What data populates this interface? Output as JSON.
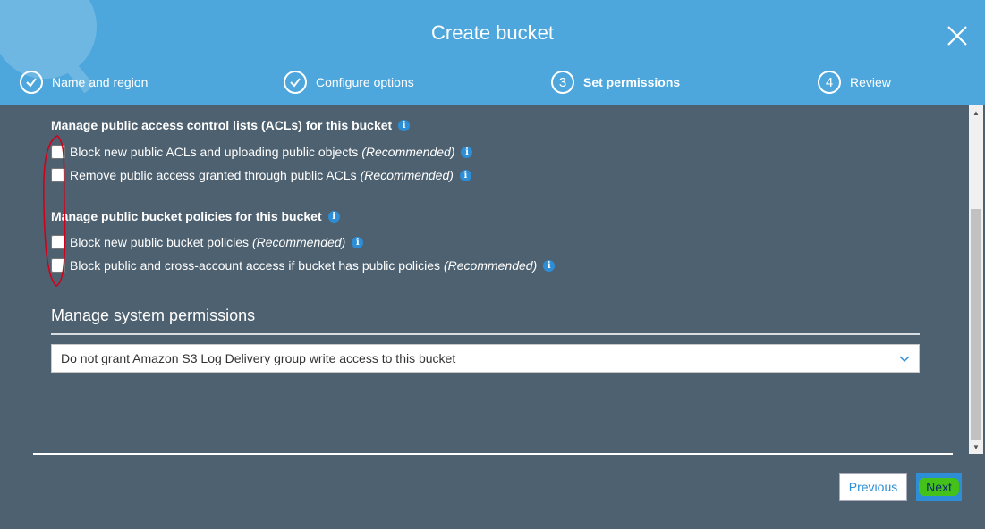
{
  "header": {
    "title": "Create bucket",
    "bg_color": "#4ea7dc",
    "close_icon": "close-x-icon"
  },
  "steps": [
    {
      "marker": "check",
      "label": "Name and region",
      "state": "complete"
    },
    {
      "marker": "check",
      "label": "Configure options",
      "state": "complete"
    },
    {
      "marker": "3",
      "label": "Set permissions",
      "state": "active"
    },
    {
      "marker": "4",
      "label": "Review",
      "state": "pending"
    }
  ],
  "acl_section": {
    "heading": "Manage public access control lists (ACLs) for this bucket",
    "options": [
      {
        "label": "Block new public ACLs and uploading public objects",
        "tag": "(Recommended)",
        "checked": false
      },
      {
        "label": "Remove public access granted through public ACLs",
        "tag": "(Recommended)",
        "checked": false
      }
    ]
  },
  "policy_section": {
    "heading": "Manage public bucket policies for this bucket",
    "options": [
      {
        "label": "Block new public bucket policies",
        "tag": "(Recommended)",
        "checked": false
      },
      {
        "label": "Block public and cross-account access if bucket has public policies",
        "tag": "(Recommended)",
        "checked": false
      }
    ]
  },
  "system_permissions": {
    "title": "Manage system permissions",
    "selected": "Do not grant Amazon S3 Log Delivery group write access to this bucket"
  },
  "footer": {
    "previous_label": "Previous",
    "next_label": "Next"
  },
  "colors": {
    "panel_bg": "#4e6170",
    "accent": "#2d8ed6",
    "annotation_red": "#d0021b",
    "highlight_green": "#44c21a"
  }
}
